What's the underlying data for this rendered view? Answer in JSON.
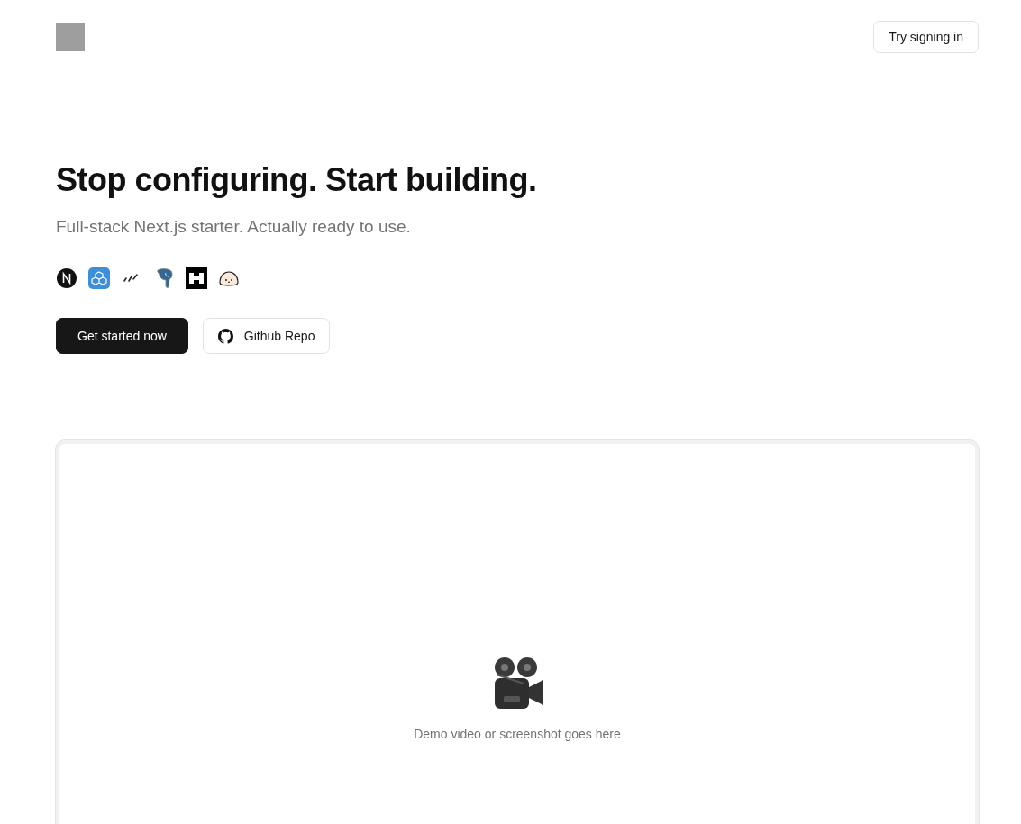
{
  "header": {
    "sign_in": "Try signing in"
  },
  "hero": {
    "title": "Stop configuring. Start building.",
    "subtitle": "Full-stack Next.js starter. Actually ready to use.",
    "buttons": [
      {
        "kind": "primary",
        "label": "Get started now"
      },
      {
        "kind": "github",
        "label": "Github Repo"
      }
    ]
  },
  "demo": {
    "caption": "Demo video or screenshot goes here"
  }
}
